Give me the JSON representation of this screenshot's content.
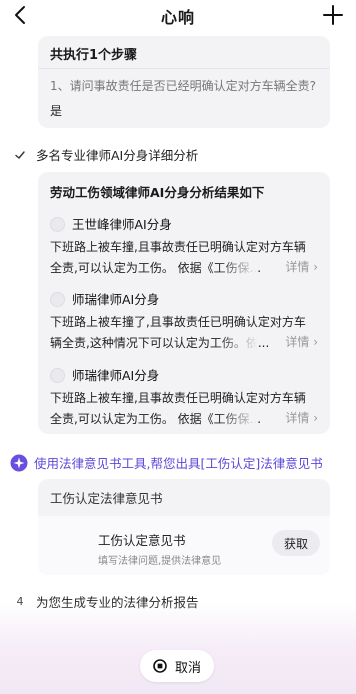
{
  "header": {
    "title": "心响",
    "back_icon": "back-chevron-icon",
    "add_icon": "plus-icon"
  },
  "step_summary": {
    "title": "共执行1个步骤",
    "question": "1、请问事故责任是否已经明确认定对方车辆全责?",
    "answer": "是"
  },
  "step2": {
    "label": "多名专业律师AI分身详细分析",
    "card_title": "劳动工伤领域律师AI分身分析结果如下",
    "lawyers": [
      {
        "name": "王世峰律师AI分身",
        "line1": "下班路上被车撞,且事故责任已明确认定对方车辆",
        "line2": "全责,可以认定为工伤。 依据《工伤保...",
        "more": "详情"
      },
      {
        "name": "师瑞律师AI分身",
        "line1": "下班路上被车撞了,且事故责任已明确认定对方车",
        "line2": "辆全责,这种情况下可以认定为工伤。依...",
        "more": "详情"
      },
      {
        "name": "师瑞律师AI分身",
        "line1": "下班路上被车撞,且事故责任已明确认定对方车辆",
        "line2": "全责,可以认定为工伤。 依据《工伤保...",
        "more": "详情"
      }
    ]
  },
  "step3": {
    "label": "使用法律意见书工具,帮您出具[工伤认定]法律意见书",
    "card_title": "工伤认定法律意见书",
    "doc_title": "工伤认定意见书",
    "doc_sub": "填写法律问题,提供法律意见",
    "get_button": "获取"
  },
  "step4": {
    "number": "4",
    "label": "为您生成专业的法律分析报告"
  },
  "cancel_button": "取消",
  "colors": {
    "accent": "#5b4ad8",
    "card_bg": "#f3f3f6"
  }
}
